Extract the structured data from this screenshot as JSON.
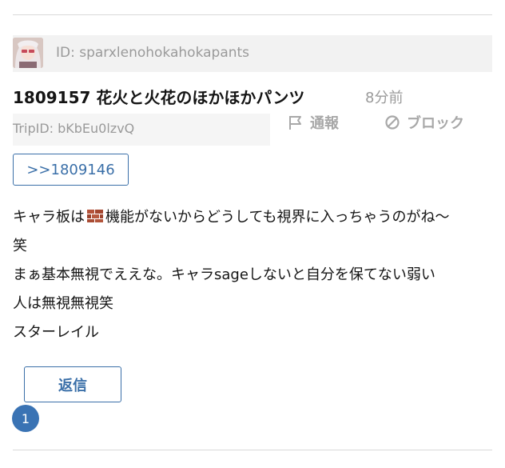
{
  "post": {
    "user_id": "ID: sparxlenohokahokapants",
    "title": "1809157 花火と火花のほかほかパンツ",
    "time_ago": "8分前",
    "trip_id": "TripID: bKbEu0lzvQ",
    "reply_ref": ">>1809146",
    "body": {
      "line1_before": "キャラ板は",
      "line1_emoji": "brick-icon",
      "line1_after": "機能がないからどうしても視界に入っちゃうのがね〜",
      "line2": "笑",
      "line3": "まぁ基本無視でええな。キャラsageしないと自分を保てない弱い",
      "line4": "人は無視無視笑",
      "line5": "スターレイル"
    },
    "reply_count": "1"
  },
  "actions": {
    "report_label": "通報",
    "block_label": "ブロック"
  },
  "reply_button_label": "返信",
  "colors": {
    "accent": "#3a6fa8",
    "muted_text": "#9a9a9a",
    "badge": "#3a73b4",
    "id_bar_bg": "#f2f2f2"
  }
}
